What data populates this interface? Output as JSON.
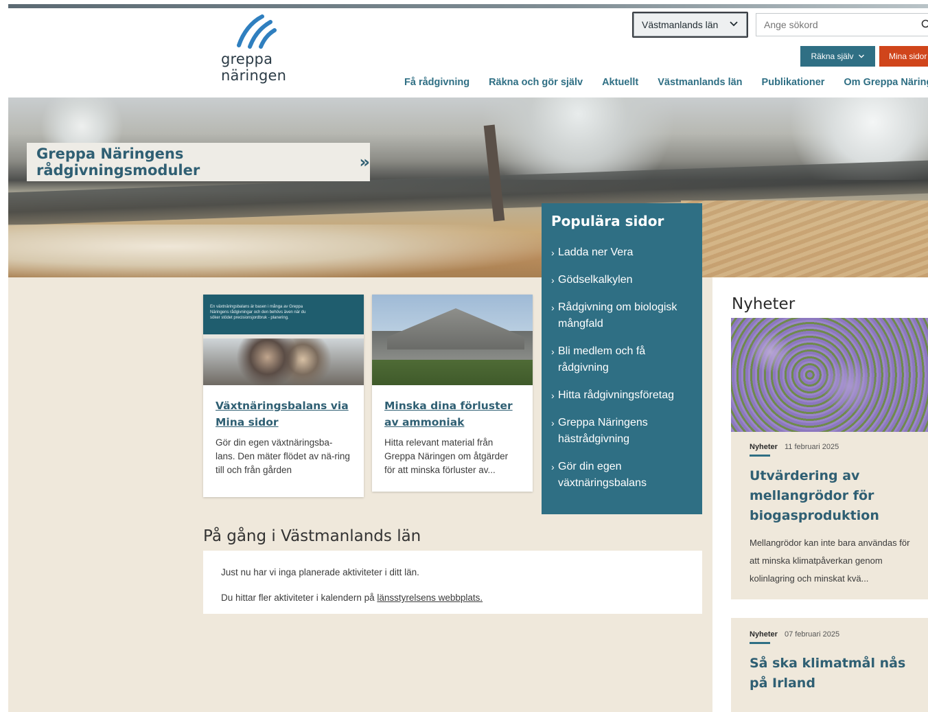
{
  "header": {
    "logo_text": "greppa näringen",
    "county_select": "Västmanlands län",
    "search_placeholder": "Ange sökord",
    "btn_rakna": "Räkna själv",
    "btn_mina": "Mina sidor",
    "nav": [
      "Få rådgivning",
      "Räkna och gör själv",
      "Aktuellt",
      "Västmanlands län",
      "Publikationer",
      "Om Greppa Näringen"
    ]
  },
  "hero": {
    "button_label": "Greppa Näringens rådgivningsmoduler"
  },
  "cards": [
    {
      "title": "Växtnäringsbalans via Mina sidor",
      "text": "Gör din egen växtnäringsba-lans. Den mäter flödet av nä-ring till och från gården",
      "image_text": "En växtnäringsbalans är basen i många av Greppa Näringens rådgivningar och den behövs även när du söker stödet precisionsjordbruk - planering."
    },
    {
      "title": "Minska dina förluster av ammoniak",
      "text": "Hitta relevant material från Greppa Näringen om åtgärder för att minska förluster av..."
    }
  ],
  "popular": {
    "title": "Populära sidor",
    "items": [
      "Ladda ner Vera",
      "Gödselkalkylen",
      "Rådgivning om biologisk mångfald",
      "Bli medlem och få rådgivning",
      "Hitta rådgivningsföretag",
      "Greppa Näringens hästrådgivning",
      "Gör din egen växtnäringsbalans"
    ]
  },
  "pagang": {
    "title": "På gång i Västmanlands län",
    "line1": "Just nu har vi inga planerade aktiviteter i ditt län.",
    "line2_prefix": "Du hittar fler aktiviteter i kalendern på ",
    "line2_link": "länsstyrelsens webbplats."
  },
  "news": {
    "title": "Nyheter",
    "items": [
      {
        "category": "Nyheter",
        "date": "11 februari 2025",
        "headline": "Utvärdering av mellangrödor för biogasproduktion",
        "excerpt": "Mellangrödor kan inte bara användas för att minska klimatpåverkan genom kolinlagring och minskat kvä..."
      },
      {
        "category": "Nyheter",
        "date": "07 februari 2025",
        "headline": "Så ska klimatmål nås på Irland",
        "excerpt": ""
      }
    ]
  },
  "colors": {
    "teal": "#2f6f84",
    "orange": "#d0451b",
    "beige": "#efe8db"
  },
  "icons": [
    "logo-mark-icon",
    "chevron-down-icon",
    "search-icon",
    "double-chevron-right-icon",
    "arrow-right-icon"
  ]
}
